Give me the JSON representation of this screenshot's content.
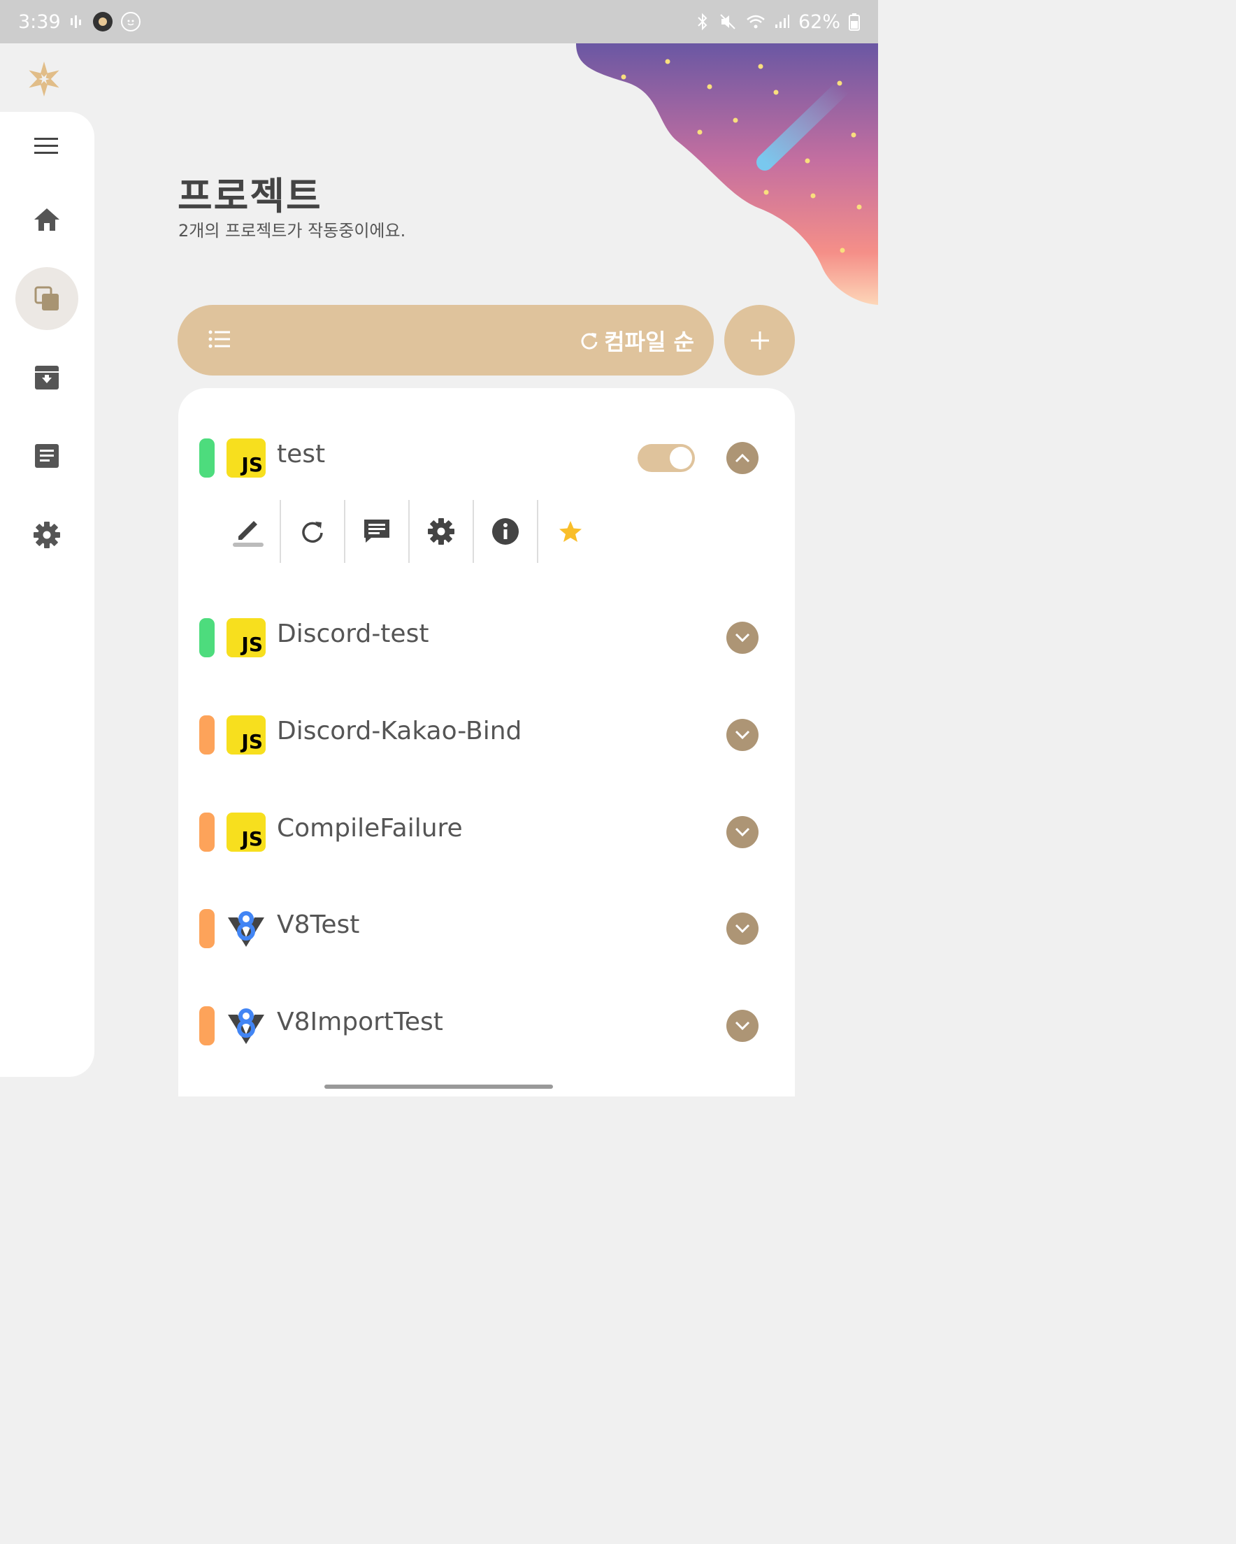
{
  "status_bar": {
    "time": "3:39",
    "battery": "62%",
    "icons": [
      "signal-bars-icon",
      "app-logo-icon",
      "smiley-icon",
      "bluetooth-icon",
      "mute-icon",
      "wifi-icon",
      "cell-signal-icon",
      "battery-icon"
    ]
  },
  "header": {
    "title": "프로젝트",
    "subtitle": "2개의 프로젝트가 작동중이에요."
  },
  "sidebar": {
    "items": [
      "menu-icon",
      "home-icon",
      "projects-icon",
      "archive-icon",
      "document-icon",
      "settings-icon"
    ],
    "active": "projects-icon"
  },
  "toolbar": {
    "sort_label": "컴파일 순"
  },
  "projects": [
    {
      "name": "test",
      "status_color": "#4ddc7d",
      "lang": "JS",
      "enabled": true,
      "expanded": true
    },
    {
      "name": "Discord-test",
      "status_color": "#4ddc7d",
      "lang": "JS",
      "expanded": false
    },
    {
      "name": "Discord-Kakao-Bind",
      "status_color": "#fda35a",
      "lang": "JS",
      "expanded": false
    },
    {
      "name": "CompileFailure",
      "status_color": "#fda35a",
      "lang": "JS",
      "expanded": false
    },
    {
      "name": "V8Test",
      "status_color": "#fda35a",
      "lang": "V8",
      "expanded": false
    },
    {
      "name": "V8ImportTest",
      "status_color": "#fda35a",
      "lang": "V8",
      "expanded": false
    }
  ],
  "project_actions": [
    "edit-icon",
    "recompile-icon",
    "chat-icon",
    "settings-icon",
    "info-icon",
    "star-icon"
  ],
  "colors": {
    "accent": "#dfc39c",
    "expand_button": "#ad9575",
    "running": "#4ddc7d",
    "stopped": "#fda35a",
    "js_yellow": "#f7df1e",
    "star": "#f9be2a"
  }
}
